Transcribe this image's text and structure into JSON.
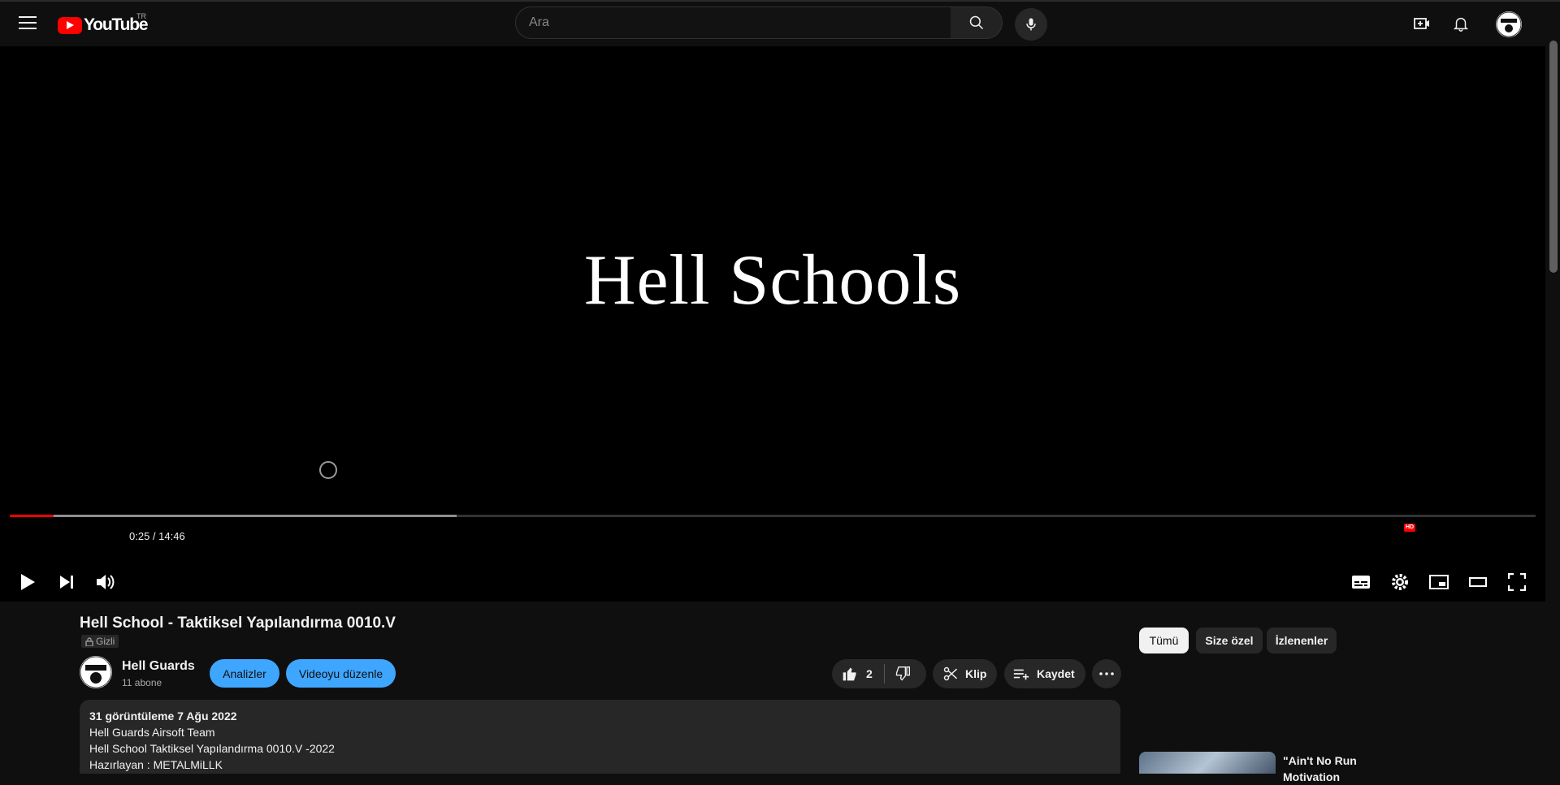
{
  "masthead": {
    "logo_text": "YouTube",
    "country_code": "TR",
    "search_placeholder": "Ara"
  },
  "player": {
    "title_card": "Hell Schools",
    "time_current": "0:25",
    "time_total": "14:46",
    "time_text": "0:25 / 14:46",
    "progress_played_fraction": 0.029,
    "progress_loaded_fraction": 0.293,
    "hd_badge": "HD"
  },
  "video": {
    "title": "Hell School - Taktiksel Yapılandırma 0010.V",
    "privacy": "Gizli",
    "channel_name": "Hell Guards",
    "subscribers": "11 abone",
    "analytics_label": "Analizler",
    "edit_label": "Videoyu düzenle",
    "like_count": "2",
    "clip_label": "Klip",
    "save_label": "Kaydet"
  },
  "description": {
    "meta": "31 görüntüleme  7 Ağu 2022",
    "lines": [
      "Hell Guards Airsoft Team",
      "Hell School Taktiksel Yapılandırma  0010.V -2022",
      "Hazırlayan : METALMiLLK"
    ]
  },
  "sidebar": {
    "chips": [
      "Tümü",
      "Size özel",
      "İzlenenler"
    ],
    "rec_title": "\"Ain't No Run Motivation"
  },
  "colors": {
    "brand_red": "#ff0000",
    "accent_blue": "#3ea6ff",
    "background": "#0f0f0f"
  },
  "icons": [
    "hamburger-icon",
    "search-icon",
    "mic-icon",
    "create-icon",
    "bell-icon",
    "play-icon",
    "next-icon",
    "volume-icon",
    "subtitles-icon",
    "settings-icon",
    "miniplayer-icon",
    "theater-icon",
    "fullscreen-icon",
    "like-icon",
    "dislike-icon",
    "scissors-icon",
    "playlist-add-icon",
    "more-icon",
    "lock-icon"
  ]
}
